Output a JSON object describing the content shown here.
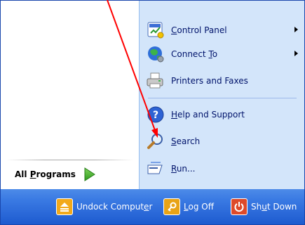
{
  "left_panel": {
    "all_programs": {
      "prefix": "All ",
      "access_key": "P",
      "rest": "rograms"
    }
  },
  "right_panel": {
    "items": [
      {
        "pre": "",
        "key": "C",
        "post": "ontrol Panel",
        "icon": "control-panel-icon",
        "submenu": true
      },
      {
        "pre": "Connect ",
        "key": "T",
        "post": "o",
        "icon": "connect-to-icon",
        "submenu": true
      },
      {
        "pre": "Printers and Faxes",
        "key": "",
        "post": "",
        "icon": "printer-icon",
        "submenu": false
      },
      {
        "pre": "",
        "key": "H",
        "post": "elp and Support",
        "icon": "help-icon",
        "submenu": false
      },
      {
        "pre": "",
        "key": "S",
        "post": "earch",
        "icon": "search-icon",
        "submenu": false
      },
      {
        "pre": "",
        "key": "R",
        "post": "un...",
        "icon": "run-icon",
        "submenu": false
      }
    ]
  },
  "bottom_bar": {
    "undock": {
      "pre": "Undock Comput",
      "key": "e",
      "post": "r",
      "icon": "undock-icon"
    },
    "log_off": {
      "pre": "",
      "key": "L",
      "post": "og Off",
      "icon": "key-icon"
    },
    "shut_down": {
      "pre": "Sh",
      "key": "u",
      "post": "t Down",
      "icon": "power-icon"
    }
  },
  "annotation": {
    "arrow_color": "#ff0000"
  },
  "colors": {
    "right_panel_bg": "#d3e5fa",
    "bottom_bar": "#2a68d8",
    "label_text": "#00136b"
  }
}
